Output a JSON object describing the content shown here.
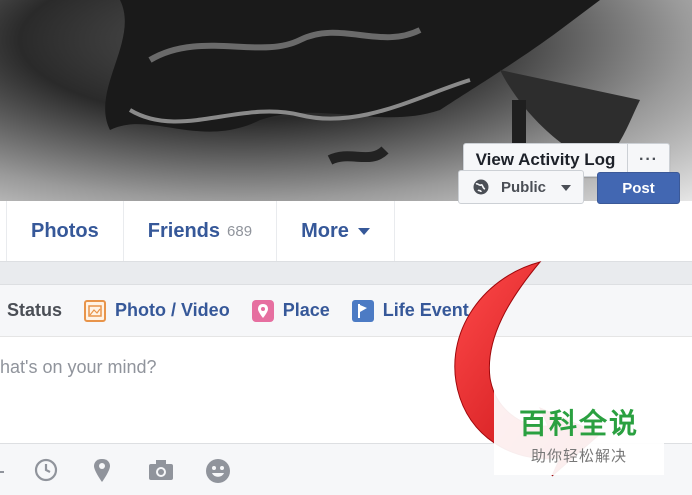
{
  "cover": {
    "view_activity_log": "View Activity Log",
    "more_dots": "···"
  },
  "tabs": [
    {
      "label": "Photos",
      "count": ""
    },
    {
      "label": "Friends",
      "count": "689"
    },
    {
      "label": "More",
      "count": ""
    }
  ],
  "composer": {
    "tabs": {
      "status": "Status",
      "photo_video": "Photo / Video",
      "place": "Place",
      "life_event": "Life Event"
    },
    "placeholder": "hat's on your mind?",
    "audience": "Public",
    "post": "Post",
    "footer_icons": [
      "tag-icon",
      "clock-icon",
      "location-pin-icon",
      "camera-icon",
      "smiley-icon"
    ]
  },
  "watermark": {
    "title": "百科全说",
    "subtitle": "助你轻松解决"
  },
  "colors": {
    "link": "#365899",
    "post_button": "#4267b2",
    "arrow": "#e3161b",
    "watermark_green": "#2aa040"
  }
}
